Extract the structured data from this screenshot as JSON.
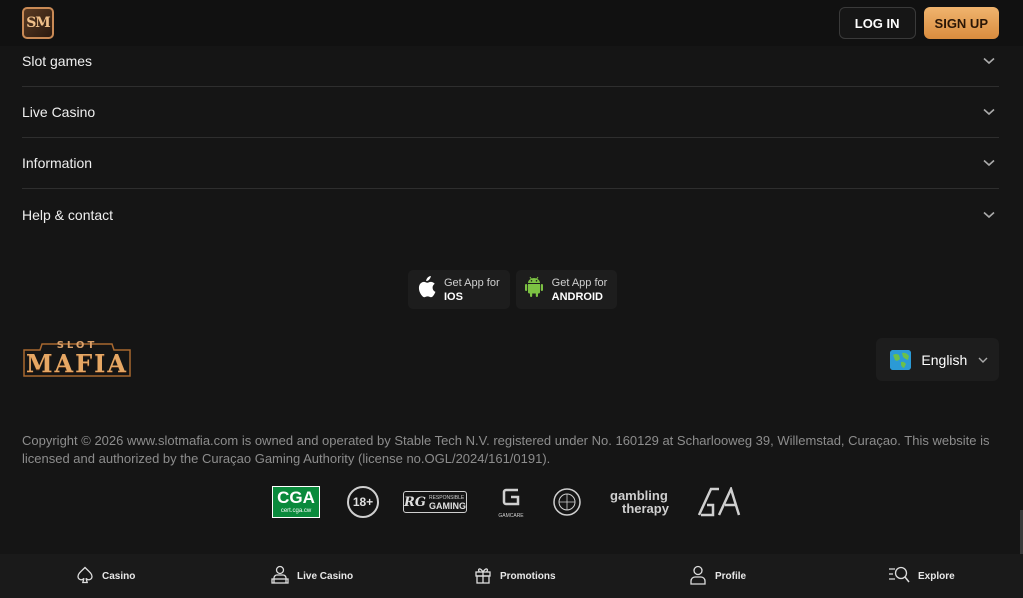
{
  "header": {
    "logo_text": "SM",
    "login_label": "LOG IN",
    "signup_label": "SIGN UP"
  },
  "accordion": {
    "items": [
      {
        "label": "Slot games"
      },
      {
        "label": "Live Casino"
      },
      {
        "label": "Information"
      },
      {
        "label": "Help & contact"
      }
    ]
  },
  "apps": {
    "ios": {
      "small": "Get App for",
      "big": "IOS"
    },
    "android": {
      "small": "Get App for",
      "big": "ANDROID"
    }
  },
  "logo": {
    "top": "SLOT",
    "main": "MAFIA"
  },
  "language": {
    "selected": "English"
  },
  "copyright": "Copyright © 2026 www.slotmafia.com is owned and operated by Stable Tech N.V. registered under No. 160129 at Scharlooweg 39, Willemstad, Curaçao. This website is licensed and authorized by the Curaçao Gaming Authority (license no.OGL/2024/161/0191).",
  "badges": {
    "cga": "CGA",
    "cga_sub": "cert.cga.cw",
    "age": "18+",
    "rg_small": "RESPONSIBLE",
    "rg_big": "GAMING",
    "gamcare": "GAMCARE",
    "gambling": "gambling",
    "therapy": "therapy",
    "ga": "GA"
  },
  "bottom_nav": [
    {
      "label": "Casino",
      "icon": "spade-icon"
    },
    {
      "label": "Live Casino",
      "icon": "dealer-icon"
    },
    {
      "label": "Promotions",
      "icon": "gift-icon"
    },
    {
      "label": "Profile",
      "icon": "user-icon"
    },
    {
      "label": "Explore",
      "icon": "search-icon"
    }
  ],
  "colors": {
    "background": "#151515",
    "accent": "#e39a4c",
    "cga_green": "#0a8a3c"
  }
}
